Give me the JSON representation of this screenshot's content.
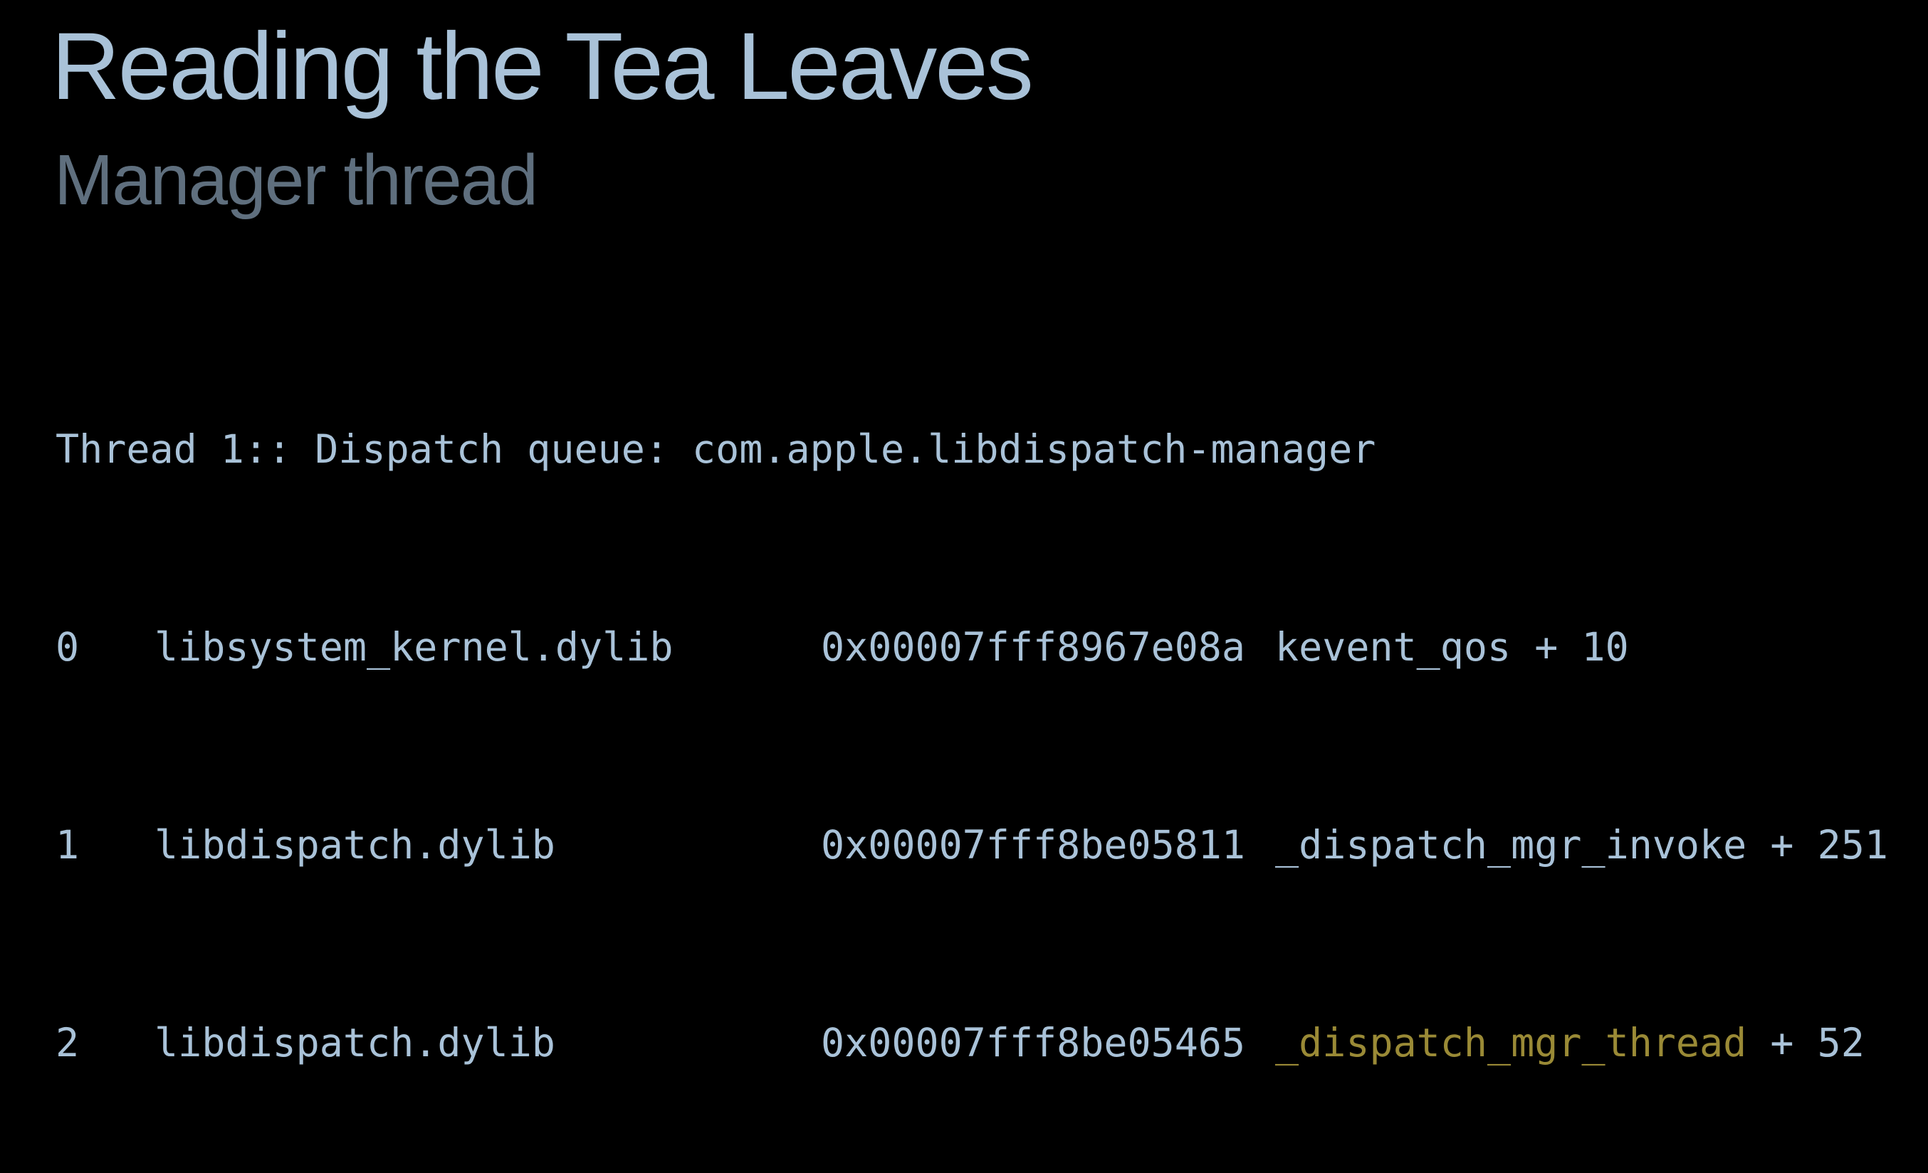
{
  "slide": {
    "title": "Reading the Tea Leaves",
    "subtitle": "Manager thread"
  },
  "code": {
    "header": "Thread 1:: Dispatch queue: com.apple.libdispatch-manager",
    "frames": [
      {
        "index": "0",
        "library": "libsystem_kernel.dylib",
        "address": "0x00007fff8967e08a",
        "symbol": "kevent_qos",
        "offset": " + 10",
        "highlighted": false
      },
      {
        "index": "1",
        "library": "libdispatch.dylib",
        "address": "0x00007fff8be05811",
        "symbol": "_dispatch_mgr_invoke",
        "offset": " + 251",
        "highlighted": false
      },
      {
        "index": "2",
        "library": "libdispatch.dylib",
        "address": "0x00007fff8be05465",
        "symbol": "_dispatch_mgr_thread",
        "offset": " + 52",
        "highlighted": true
      }
    ]
  },
  "colors": {
    "background": "#000000",
    "text": "#a9c2d8",
    "subtitle": "#5f6f7e",
    "highlight": "#9a8a36"
  }
}
